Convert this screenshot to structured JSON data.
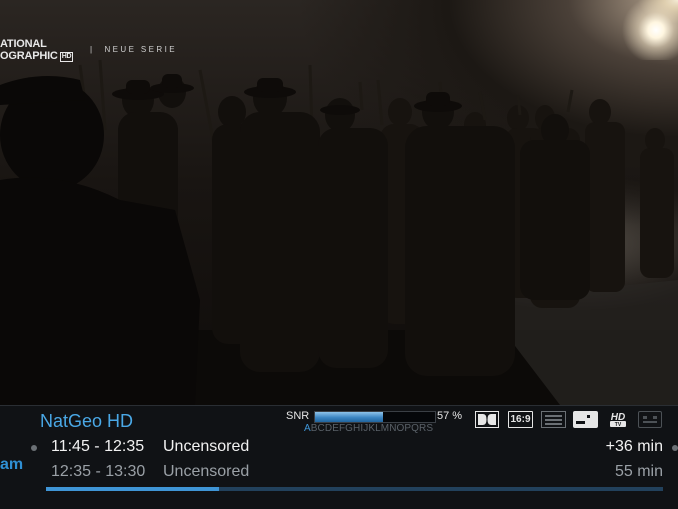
{
  "overlay": {
    "channel_logo_line1": "ATIONAL",
    "channel_logo_line2": "OGRAPHIC",
    "channel_logo_badge": "HD",
    "separator": "|",
    "promo_text": "NEUE SERIE"
  },
  "infobar": {
    "channel_name": "NatGeo HD",
    "prev_channel_fragment": "am",
    "now": {
      "time": "11:45 - 12:35",
      "title": "Uncensored",
      "remaining": "+36 min"
    },
    "next": {
      "time": "12:35 - 13:30",
      "title": "Uncensored",
      "duration": "55 min"
    },
    "progress_fraction": 0.28,
    "snr": {
      "label": "SNR",
      "value_text": "57 %",
      "fraction": 0.57,
      "letters_first": "A",
      "letters_rest": "BCDEFGHIJKLMNOPQRS"
    },
    "icons": {
      "dolby": "dolby-digital-icon",
      "aspect": "16:9",
      "teletext": "teletext-icon",
      "subtitle": "subtitle-icon",
      "hd": "hdtv-icon",
      "cam": "ci-module-icon"
    },
    "hd_badge_top": "HD",
    "hd_badge_bottom": "TV"
  },
  "colors": {
    "accent": "#3f95d6",
    "bar_background": "#101215",
    "text_primary": "#f2f2f2",
    "text_secondary": "#9aa0a6"
  }
}
